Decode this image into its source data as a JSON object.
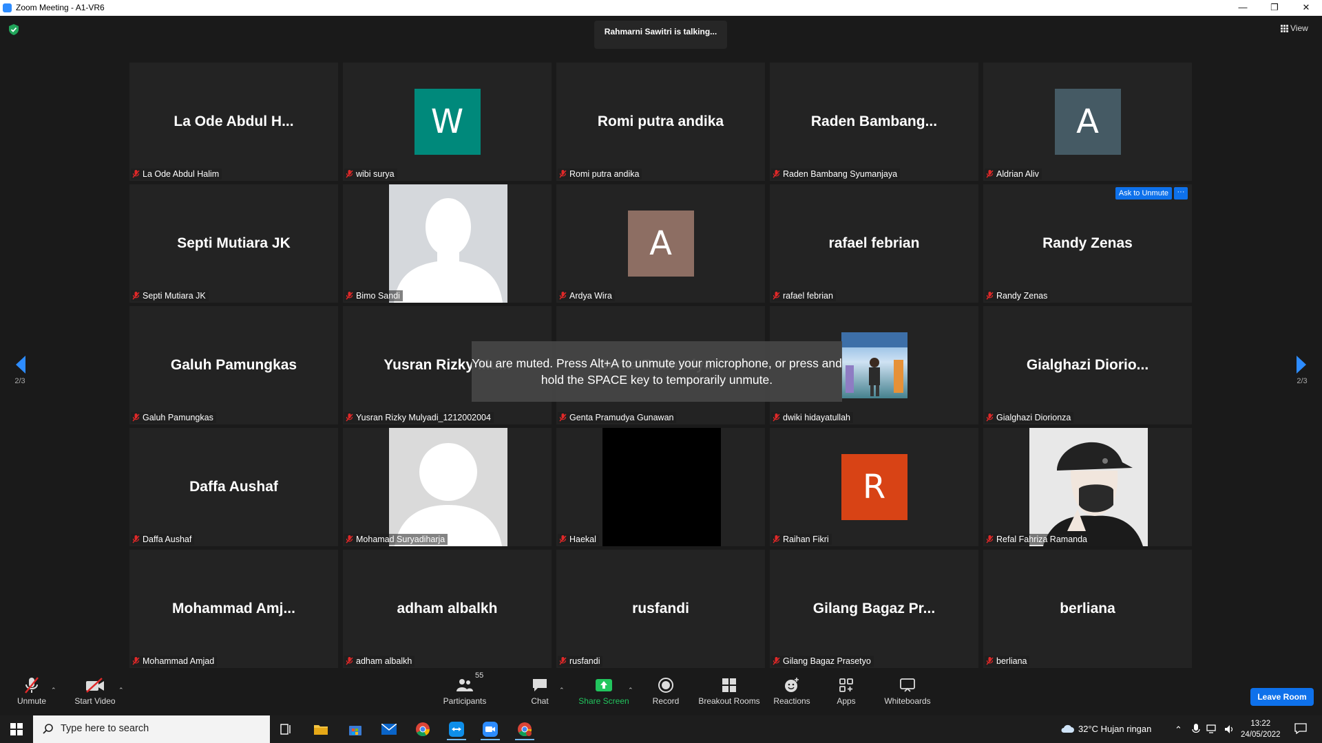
{
  "window": {
    "title": "Zoom Meeting - A1-VR6",
    "minimize": "—",
    "restore": "❐",
    "close": "✕"
  },
  "meeting": {
    "talking_banner": "Rahmarni Sawitri is talking...",
    "view_label": "View",
    "muted_toast": "You are muted. Press Alt+A to unmute your microphone, or press and hold the SPACE key to temporarily unmute.",
    "page_indicator_left": "2/3",
    "page_indicator_right": "2/3"
  },
  "participants": [
    {
      "display": "La Ode Abdul H...",
      "name": "La Ode Abdul Halim"
    },
    {
      "avatar_letter": "W",
      "avatar_color": "#00897b",
      "name": "wibi surya"
    },
    {
      "display": "Romi putra andika",
      "name": "Romi putra andika"
    },
    {
      "display": "Raden  Bambang...",
      "name": "Raden Bambang Syumanjaya"
    },
    {
      "avatar_letter": "A",
      "avatar_color": "#455a64",
      "name": "Aldrian Aliv"
    },
    {
      "display": "Septi Mutiara JK",
      "name": "Septi Mutiara JK"
    },
    {
      "photo": "silhouette",
      "name": "Bimo Sandi"
    },
    {
      "avatar_letter": "A",
      "avatar_color": "#8d6e63",
      "name": "Ardya Wira"
    },
    {
      "display": "rafael febrian",
      "name": "rafael febrian"
    },
    {
      "display": "Randy Zenas",
      "name": "Randy Zenas",
      "ask_to_unmute": "Ask to Unmute",
      "more": "···"
    },
    {
      "display": "Galuh Pamungkas",
      "name": "Galuh Pamungkas"
    },
    {
      "display": "Yusran Rizky  Mu...",
      "name": "Yusran Rizky Mulyadi_1212002004"
    },
    {
      "display": "Genta Pramudya...",
      "name": "Genta Pramudya Gunawan"
    },
    {
      "photo": "event",
      "name": "dwiki hidayatullah"
    },
    {
      "display": "Gialghazi  Diorio...",
      "name": "Gialghazi Diorionza"
    },
    {
      "display": "Daffa Aushaf",
      "name": "Daffa Aushaf"
    },
    {
      "photo": "default",
      "name": "Mohamad Suryadiharja"
    },
    {
      "photo": "black",
      "name": "Haekal"
    },
    {
      "avatar_letter": "R",
      "avatar_color": "#d84315",
      "name": "Raihan Fikri"
    },
    {
      "photo": "cap-drawing",
      "name": "Refal Fahriza Ramanda"
    },
    {
      "display": "Mohammad  Amj...",
      "name": "Mohammad Amjad"
    },
    {
      "display": "adham albalkh",
      "name": "adham albalkh"
    },
    {
      "display": "rusfandi",
      "name": "rusfandi"
    },
    {
      "display": "Gilang Bagaz Pr...",
      "name": "Gilang Bagaz Prasetyo"
    },
    {
      "display": "berliana",
      "name": "berliana"
    }
  ],
  "toolbar": {
    "unmute": "Unmute",
    "start_video": "Start Video",
    "participants": "Participants",
    "participants_count": "55",
    "chat": "Chat",
    "share_screen": "Share Screen",
    "record": "Record",
    "breakout_rooms": "Breakout Rooms",
    "reactions": "Reactions",
    "apps": "Apps",
    "whiteboards": "Whiteboards",
    "leave_room": "Leave Room",
    "share_color": "#22c55e"
  },
  "taskbar": {
    "search_placeholder": "Type here to search",
    "weather": "32°C  Hujan ringan",
    "time": "13:22",
    "date": "24/05/2022"
  }
}
